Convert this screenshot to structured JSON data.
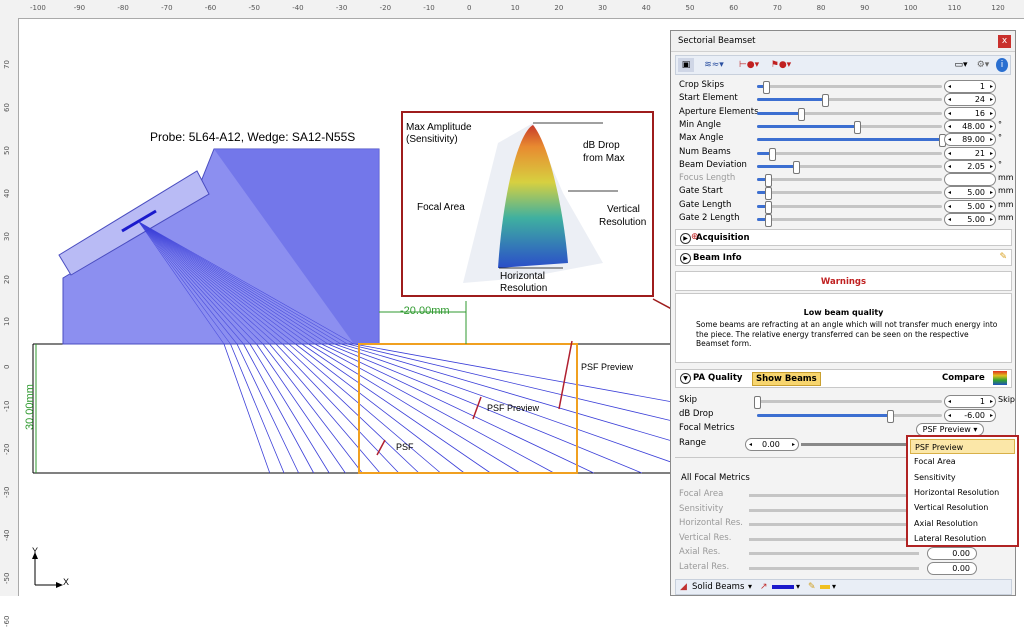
{
  "ruler": {
    "top_ticks": [
      "-100",
      "-90",
      "-80",
      "-70",
      "-60",
      "-50",
      "-40",
      "-30",
      "-20",
      "-10",
      "0",
      "10",
      "20",
      "30",
      "40",
      "50",
      "60",
      "70",
      "80",
      "90",
      "100",
      "110",
      "120"
    ],
    "left_ticks": [
      "70",
      "60",
      "50",
      "40",
      "30",
      "20",
      "10",
      "0",
      "-10",
      "-20",
      "-30",
      "-40",
      "-50",
      "-60"
    ]
  },
  "canvas": {
    "probe_label": "Probe: 5L64-A12, Wedge: SA12-N55S",
    "dim_horizontal": "-20.00mm",
    "dim_vertical": "30.00mm",
    "psf_labels": [
      "PSF",
      "PSF Preview",
      "PSF Preview"
    ],
    "axis_x": "X",
    "axis_y": "Y"
  },
  "inset": {
    "max_amplitude": "Max Amplitude",
    "sensitivity": "(Sensitivity)",
    "db_drop": "dB Drop",
    "from_max": "from Max",
    "focal_area": "Focal Area",
    "vertical": "Vertical",
    "resolution_v": "Resolution",
    "horizontal": "Horizontal",
    "resolution_h": "Resolution"
  },
  "panel": {
    "title": "Sectorial Beamset",
    "close": "x",
    "toolbar_icons": [
      "beamset-icon",
      "wave-icon",
      "gate-icon",
      "pin-icon",
      "display-icon",
      "gear-icon",
      "info-icon"
    ],
    "params": [
      {
        "label": "Crop Skips",
        "value": "1",
        "unit": "",
        "fill": 0.05,
        "disabled": false
      },
      {
        "label": "Start Element",
        "value": "24",
        "unit": "",
        "fill": 0.37,
        "disabled": false
      },
      {
        "label": "Aperture Elements",
        "value": "16",
        "unit": "",
        "fill": 0.24,
        "disabled": false
      },
      {
        "label": "Min Angle",
        "value": "48.00",
        "unit": "°",
        "fill": 0.54,
        "disabled": false
      },
      {
        "label": "Max Angle",
        "value": "89.00",
        "unit": "°",
        "fill": 1.0,
        "disabled": false
      },
      {
        "label": "Num Beams",
        "value": "21",
        "unit": "",
        "fill": 0.08,
        "disabled": false
      },
      {
        "label": "Beam Deviation",
        "value": "2.05",
        "unit": "°",
        "fill": 0.21,
        "disabled": false
      },
      {
        "label": "Focus Length",
        "value": "",
        "unit": "mm",
        "fill": 0.06,
        "disabled": true
      },
      {
        "label": "Gate Start",
        "value": "5.00",
        "unit": "mm",
        "fill": 0.06,
        "disabled": false
      },
      {
        "label": "Gate Length",
        "value": "5.00",
        "unit": "mm",
        "fill": 0.06,
        "disabled": false
      },
      {
        "label": "Gate 2 Length",
        "value": "5.00",
        "unit": "mm",
        "fill": 0.06,
        "disabled": false
      }
    ],
    "acquisition": "Acquisition",
    "beam_info": "Beam Info",
    "warnings": "Warnings",
    "warning_title": "Low beam quality",
    "warning_text": "Some beams are refracting at an angle which will not transfer much energy into the piece. The relative energy transferred can be seen on the respective Beamset form.",
    "pa_quality": "PA Quality",
    "show_beams": "Show Beams",
    "compare": "Compare",
    "skip_label": "Skip",
    "skip_value": "1",
    "skip_unit": "Skip",
    "db_drop_label": "dB Drop",
    "db_drop_value": "-6.00",
    "focal_metrics_label": "Focal Metrics",
    "focal_metrics_value": "PSF Preview",
    "range_label": "Range",
    "range_value": "0.00",
    "all_focal_metrics": "All Focal Metrics",
    "metrics": [
      {
        "label": "Focal Area",
        "value": ""
      },
      {
        "label": "Sensitivity",
        "value": ""
      },
      {
        "label": "Horizontal Res.",
        "value": ""
      },
      {
        "label": "Vertical Res.",
        "value": ""
      },
      {
        "label": "Axial Res.",
        "value": "0.00"
      },
      {
        "label": "Lateral Res.",
        "value": "0.00"
      }
    ],
    "bottom_toolbar": "Solid Beams"
  },
  "dropdown": {
    "items": [
      "PSF Preview",
      "Focal Area",
      "Sensitivity",
      "Horizontal Resolution",
      "Vertical Resolution",
      "Axial Resolution",
      "Lateral Resolution"
    ],
    "selected": 0
  },
  "colors": {
    "wedge": "#8c8ff0",
    "beam": "#3b3fd8",
    "roi": "#f0a020",
    "dim": "#2f9a2f",
    "callout": "#9e1c1c"
  }
}
